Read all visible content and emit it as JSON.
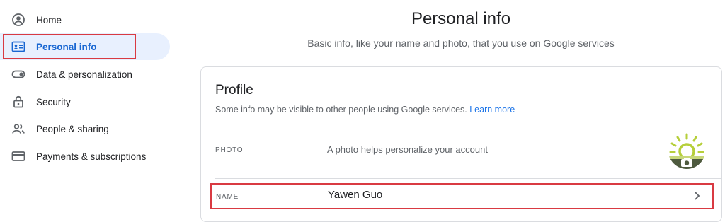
{
  "sidebar": {
    "items": [
      {
        "label": "Home",
        "icon": "account-circle-icon"
      },
      {
        "label": "Personal info",
        "icon": "id-card-icon",
        "active": true
      },
      {
        "label": "Data & personalization",
        "icon": "toggle-icon"
      },
      {
        "label": "Security",
        "icon": "lock-icon"
      },
      {
        "label": "People & sharing",
        "icon": "people-icon"
      },
      {
        "label": "Payments & subscriptions",
        "icon": "credit-card-icon"
      }
    ]
  },
  "header": {
    "title": "Personal info",
    "subtitle": "Basic info, like your name and photo, that you use on Google services"
  },
  "profile": {
    "title": "Profile",
    "description": "Some info may be visible to other people using Google services.",
    "learn_more": "Learn more",
    "photo": {
      "label": "PHOTO",
      "text": "A photo helps personalize your account",
      "icon": "camera-icon"
    },
    "name": {
      "label": "NAME",
      "value": "Yawen Guo",
      "icon": "chevron-right-icon"
    }
  },
  "colors": {
    "accent": "#1967d2",
    "active_bg": "#e8f0fe",
    "highlight_border": "#d93a42",
    "link": "#1a73e8"
  }
}
